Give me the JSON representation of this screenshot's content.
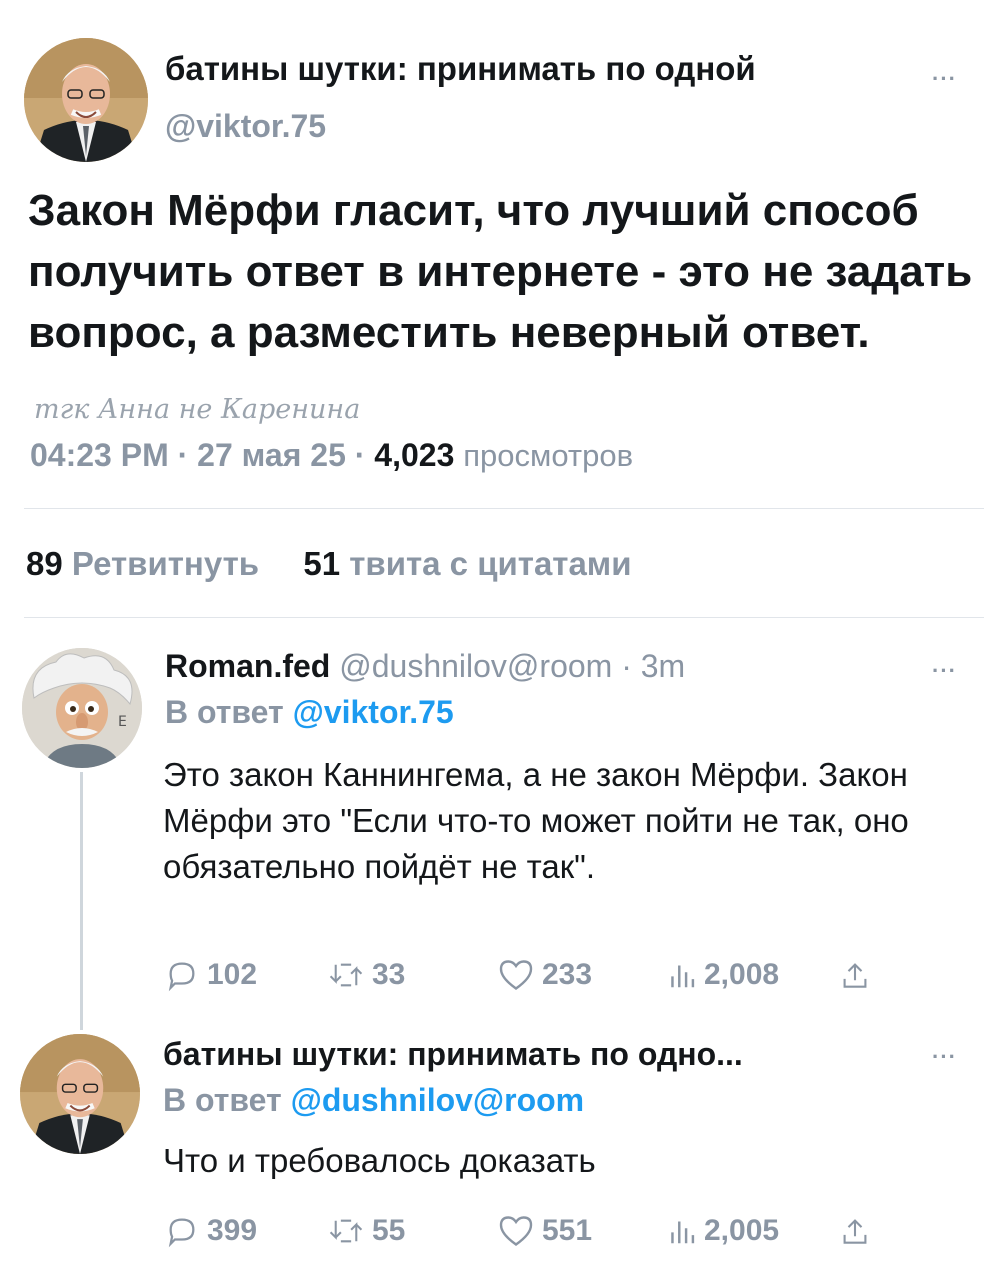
{
  "main_tweet": {
    "display_name": "батины шутки: принимать по одной",
    "handle": "@viktor.75",
    "more": "···",
    "text": "Закон Мёрфи гласит, что лучший способ получить ответ в интернете - это не задать вопрос, а разместить неверный ответ.",
    "watermark": "тгк Анна не Каренина",
    "time": "04:23 PM",
    "date": "27 мая 25",
    "separator": "·",
    "views_count": "4,023",
    "views_label": "просмотров",
    "retweets_count": "89",
    "retweets_label": "Ретвитнуть",
    "quotes_count": "51",
    "quotes_label": "твита с цитатами"
  },
  "replies": [
    {
      "display_name": "Roman.fed",
      "handle": "@dushnilov@room",
      "separator": "·",
      "time": "3m",
      "more": "···",
      "reply_prefix": "В ответ",
      "reply_mention": "@viktor.75",
      "text": "Это закон Каннингема, а не закон Мёрфи. Закон Мёрфи это \"Если что-то может пойти не так, оно обязательно пойдёт не так\".",
      "replies": "102",
      "retweets": "33",
      "likes": "233",
      "views": "2,008"
    },
    {
      "display_name": "батины шутки: принимать по одно...",
      "more": "···",
      "reply_prefix": "В ответ",
      "reply_mention": "@dushnilov@room",
      "text": "Что и требовалось доказать",
      "replies": "399",
      "retweets": "55",
      "likes": "551",
      "views": "2,005"
    }
  ],
  "colors": {
    "text": "#14171a",
    "secondary": "#8a95a3",
    "link": "#1d9bf0",
    "divider": "#e1e5ea"
  },
  "icons": [
    "reply-icon",
    "retweet-icon",
    "like-icon",
    "views-icon",
    "share-icon",
    "more-icon"
  ]
}
